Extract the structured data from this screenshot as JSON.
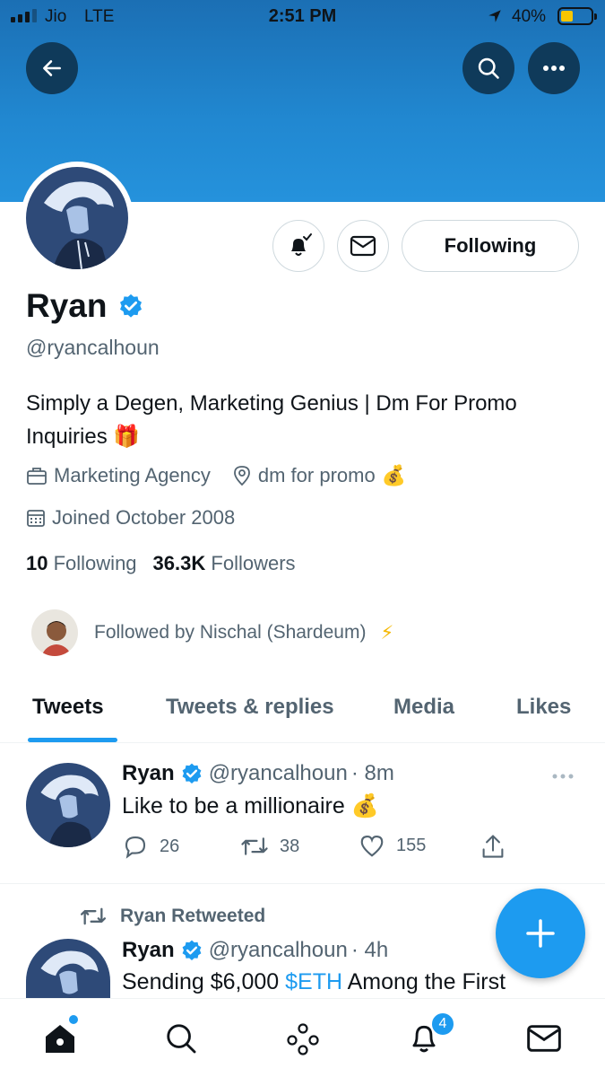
{
  "status_bar": {
    "carrier": "Jio",
    "network": "LTE",
    "time": "2:51 PM",
    "battery_pct": "40%",
    "battery_level": 0.4,
    "battery_color": "#f7c600"
  },
  "header": {
    "back_icon": "arrow-left-icon",
    "search_icon": "search-icon",
    "more_icon": "more-horizontal-icon"
  },
  "profile": {
    "name": "Ryan",
    "verified": true,
    "handle": "@ryancalhoun",
    "bio": "Simply a Degen, Marketing Genius | Dm For Promo Inquiries",
    "bio_emoji": "🎁",
    "category": "Marketing Agency",
    "location": "dm for promo",
    "location_emoji": "💰",
    "joined": "Joined October 2008",
    "following_count": "10",
    "following_label": "Following",
    "followers_count": "36.3K",
    "followers_label": "Followers",
    "followed_by": "Followed by Nischal (Shardeum)",
    "followed_by_emoji": "⚡"
  },
  "actions": {
    "following_button": "Following"
  },
  "tabs": [
    {
      "label": "Tweets",
      "active": true
    },
    {
      "label": "Tweets & replies",
      "active": false
    },
    {
      "label": "Media",
      "active": false
    },
    {
      "label": "Likes",
      "active": false
    }
  ],
  "tweets": [
    {
      "name": "Ryan",
      "handle": "@ryancalhoun",
      "time": "· 8m",
      "text": "Like to be a millionaire",
      "emoji": "💰",
      "replies": "26",
      "retweets": "38",
      "likes": "155"
    },
    {
      "retweeted_label": "Ryan Retweeted",
      "name": "Ryan",
      "handle": "@ryancalhoun",
      "time": "· 4h",
      "text_before": "Sending $6,000 ",
      "cashtag": "$ETH",
      "text_after": " Among the First"
    }
  ],
  "bottom_nav": {
    "notifications_badge": "4"
  },
  "colors": {
    "accent": "#1d9bf0",
    "banner": "#2188d1",
    "text_secondary": "#536471"
  }
}
